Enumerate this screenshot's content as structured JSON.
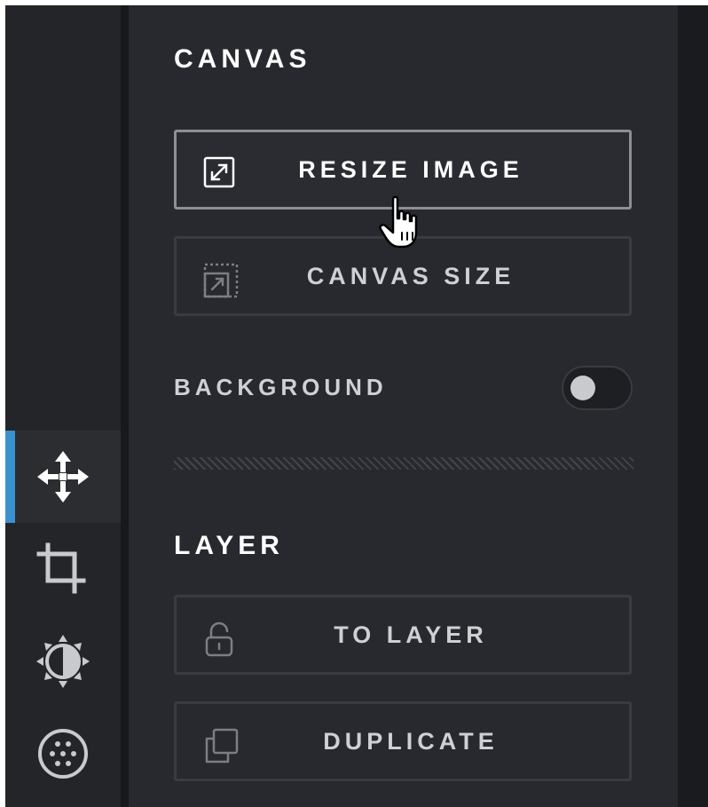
{
  "sidebar": {
    "active_color": "#3b91cf",
    "tools": [
      {
        "icon": "move-icon",
        "active": true
      },
      {
        "icon": "crop-icon",
        "active": false
      },
      {
        "icon": "brightness-icon",
        "active": false
      },
      {
        "icon": "texture-icon",
        "active": false
      }
    ]
  },
  "canvas": {
    "title": "CANVAS",
    "resize_button": {
      "label": "RESIZE IMAGE",
      "icon": "resize-icon"
    },
    "canvas_size_button": {
      "label": "CANVAS SIZE",
      "icon": "canvas-size-icon"
    },
    "background": {
      "label": "BACKGROUND",
      "enabled": false
    }
  },
  "layer": {
    "title": "LAYER",
    "to_layer_button": {
      "label": "TO LAYER",
      "icon": "unlock-icon"
    },
    "duplicate_button": {
      "label": "DUPLICATE",
      "icon": "duplicate-icon"
    }
  }
}
